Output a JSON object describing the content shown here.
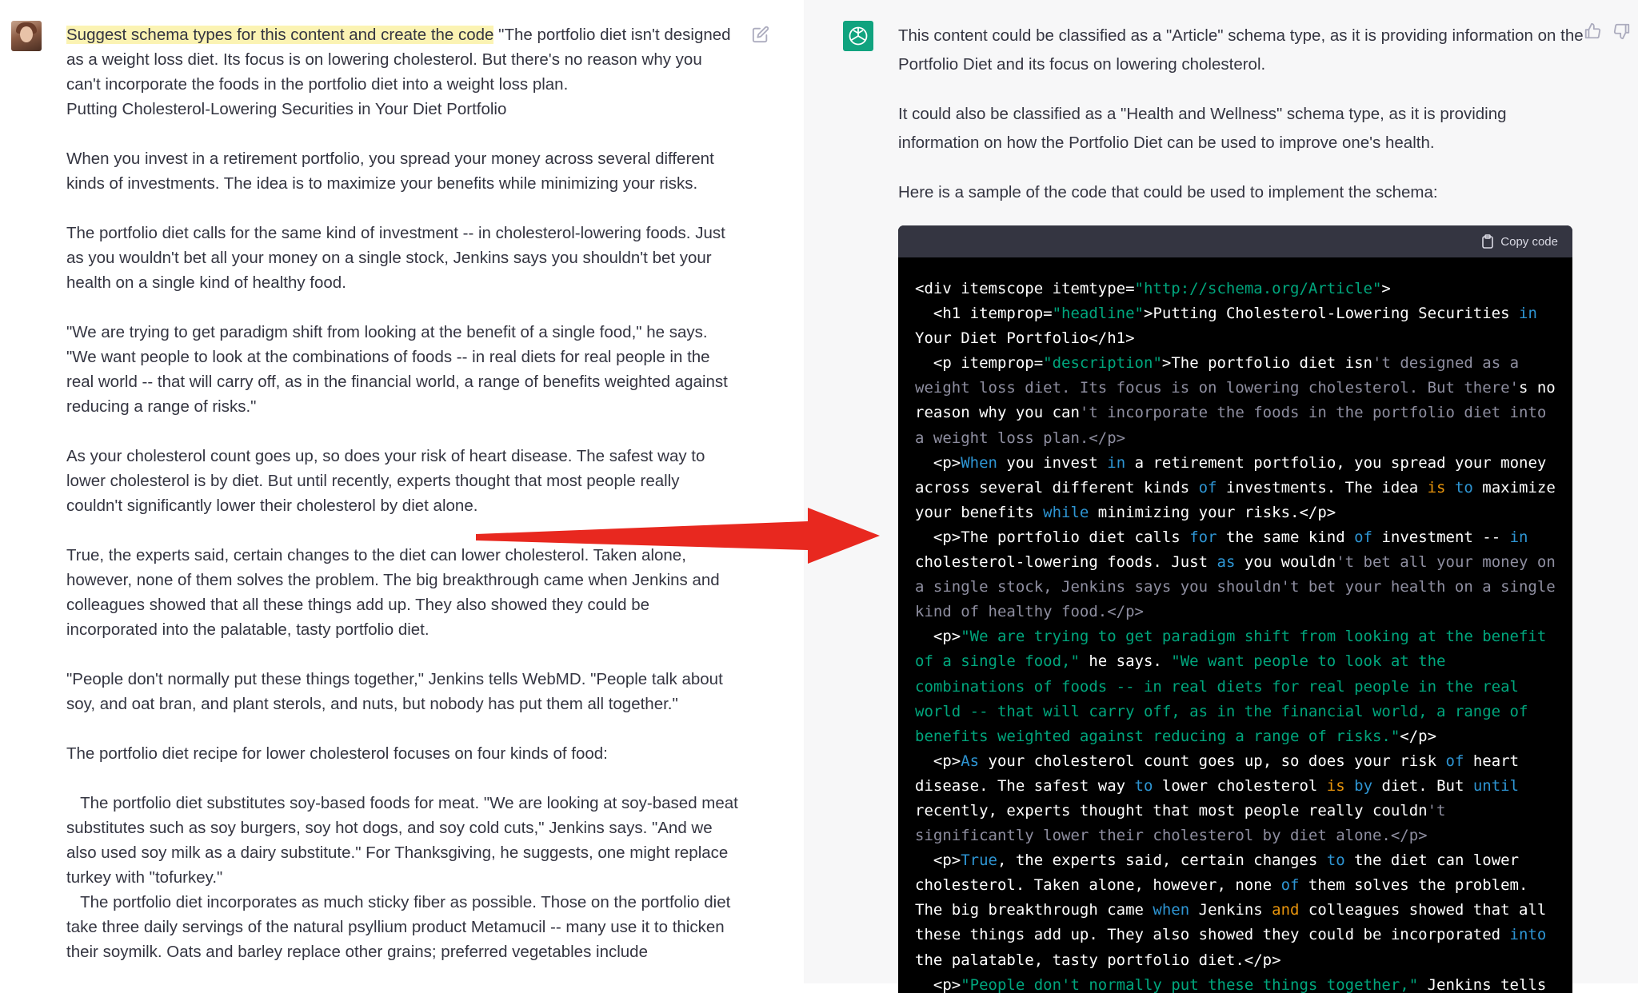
{
  "user_message": {
    "highlighted_prompt": "Suggest schema types for this content and create the code",
    "paragraphs": [
      " \"The portfolio diet isn't designed as a weight loss diet. Its focus is on lowering cholesterol. But there's no reason why you can't incorporate the foods in the portfolio diet into a weight loss plan.\nPutting Cholesterol-Lowering Securities in Your Diet Portfolio",
      "When you invest in a retirement portfolio, you spread your money across several different kinds of investments. The idea is to maximize your benefits while minimizing your risks.",
      "The portfolio diet calls for the same kind of investment -- in cholesterol-lowering foods. Just as you wouldn't bet all your money on a single stock, Jenkins says you shouldn't bet your health on a single kind of healthy food.",
      "\"We are trying to get paradigm shift from looking at the benefit of a single food,\" he says. \"We want people to look at the combinations of foods -- in real diets for real people in the real world -- that will carry off, as in the financial world, a range of benefits weighted against reducing a range of risks.\"",
      "As your cholesterol count goes up, so does your risk of heart disease. The safest way to lower cholesterol is by diet. But until recently, experts thought that most people really couldn't significantly lower their cholesterol by diet alone.",
      "True, the experts said, certain changes to the diet can lower cholesterol. Taken alone, however, none of them solves the problem. The big breakthrough came when Jenkins and colleagues showed that all these things add up. They also showed they could be incorporated into the palatable, tasty portfolio diet.",
      "\"People don't normally put these things together,\" Jenkins tells WebMD. \"People talk about soy, and oat bran, and plant sterols, and nuts, but nobody has put them all together.\"",
      "The portfolio diet recipe for lower cholesterol focuses on four kinds of food:",
      "   The portfolio diet substitutes soy-based foods for meat. \"We are looking at soy-based meat substitutes such as soy burgers, soy hot dogs, and soy cold cuts,\" Jenkins says. \"And we also used soy milk as a dairy substitute.\" For Thanksgiving, he suggests, one might replace turkey with \"tofurkey.\"\n   The portfolio diet incorporates as much sticky fiber as possible. Those on the portfolio diet take three daily servings of the natural psyllium product Metamucil -- many use it to thicken their soymilk. Oats and barley replace other grains; preferred vegetables include"
    ]
  },
  "assistant_message": {
    "paragraphs": [
      "This content could be classified as a \"Article\" schema type, as it is providing information on the Portfolio Diet and its focus on lowering cholesterol.",
      "It could also be classified as a \"Health and Wellness\" schema type, as it is providing information on how the Portfolio Diet can be used to improve one's health.",
      "Here is a sample of the code that could be used to implement the schema:"
    ],
    "copy_label": "Copy code",
    "code_tokens": [
      [
        "",
        "<div itemscope itemtype="
      ],
      [
        "str",
        "\"http://schema.org/Article\""
      ],
      [
        "",
        ">\n  <h1 itemprop="
      ],
      [
        "str",
        "\"headline\""
      ],
      [
        "",
        ">Putting Cholesterol-Lowering Securities "
      ],
      [
        "kw",
        "in"
      ],
      [
        "",
        " Your Diet Portfolio</h1>\n  <p itemprop="
      ],
      [
        "str",
        "\"description\""
      ],
      [
        "",
        ">The portfolio diet isn"
      ],
      [
        "grey",
        "'t designed as a weight loss diet. Its focus is on lowering cholesterol. But there'"
      ],
      [
        "",
        "s no reason why you can"
      ],
      [
        "grey",
        "'t incorporate the foods in the portfolio diet into a weight loss plan.</p>"
      ],
      [
        "",
        "\n  <p>"
      ],
      [
        "kw",
        "When"
      ],
      [
        "",
        " you invest "
      ],
      [
        "kw",
        "in"
      ],
      [
        "",
        " a retirement portfolio, you spread your money across several different kinds "
      ],
      [
        "kw",
        "of"
      ],
      [
        "",
        " investments. The idea "
      ],
      [
        "yel",
        "is"
      ],
      [
        "",
        " "
      ],
      [
        "kw",
        "to"
      ],
      [
        "",
        " maximize your benefits "
      ],
      [
        "kw",
        "while"
      ],
      [
        "",
        " minimizing your risks.</p>\n  <p>The portfolio diet calls "
      ],
      [
        "kw",
        "for"
      ],
      [
        "",
        " the same kind "
      ],
      [
        "kw",
        "of"
      ],
      [
        "",
        " investment -- "
      ],
      [
        "kw",
        "in"
      ],
      [
        "",
        " cholesterol-lowering foods. Just "
      ],
      [
        "kw",
        "as"
      ],
      [
        "",
        " you wouldn"
      ],
      [
        "grey",
        "'t bet all your money on a single stock, Jenkins says you shouldn't bet your health on a single kind of healthy food.</p>"
      ],
      [
        "",
        "\n  <p>"
      ],
      [
        "str",
        "\"We are trying to get paradigm shift from looking at the benefit of a single food,\""
      ],
      [
        "",
        " he says. "
      ],
      [
        "str",
        "\"We want people to look at the combinations of foods -- in real diets for real people in the real world -- that will carry off, as in the financial world, a range of benefits weighted against reducing a range of risks.\""
      ],
      [
        "",
        "</p>\n  <p>"
      ],
      [
        "kw",
        "As"
      ],
      [
        "",
        " your cholesterol count goes up, so does your risk "
      ],
      [
        "kw",
        "of"
      ],
      [
        "",
        " heart disease. The safest way "
      ],
      [
        "kw",
        "to"
      ],
      [
        "",
        " lower cholesterol "
      ],
      [
        "yel",
        "is"
      ],
      [
        "",
        " "
      ],
      [
        "kw",
        "by"
      ],
      [
        "",
        " diet. But "
      ],
      [
        "kw",
        "until"
      ],
      [
        "",
        " recently, experts thought that most people really couldn"
      ],
      [
        "grey",
        "'t significantly lower their cholesterol by diet alone.</p>"
      ],
      [
        "",
        "\n  <p>"
      ],
      [
        "kw",
        "True"
      ],
      [
        "",
        ", the experts said, certain changes "
      ],
      [
        "kw",
        "to"
      ],
      [
        "",
        " the diet can lower cholesterol. Taken alone, however, none "
      ],
      [
        "kw",
        "of"
      ],
      [
        "",
        " them solves the problem. The big breakthrough came "
      ],
      [
        "kw",
        "when"
      ],
      [
        "",
        " Jenkins "
      ],
      [
        "yel",
        "and"
      ],
      [
        "",
        " colleagues showed that all these things add up. They also showed they could be incorporated "
      ],
      [
        "kw",
        "into"
      ],
      [
        "",
        " the palatable, tasty portfolio diet.</p>\n  <p>"
      ],
      [
        "str",
        "\"People don't normally put these things together,\""
      ],
      [
        "",
        " Jenkins tells"
      ]
    ]
  },
  "colors": {
    "highlight": "#fbf3b3",
    "arrow": "#e8281f",
    "gpt_logo": "#10a37f",
    "code_bg": "#000000"
  },
  "icons": [
    "user-avatar",
    "edit-icon",
    "openai-logo-icon",
    "thumbs-up-icon",
    "thumbs-down-icon",
    "clipboard-icon",
    "red-arrow"
  ]
}
